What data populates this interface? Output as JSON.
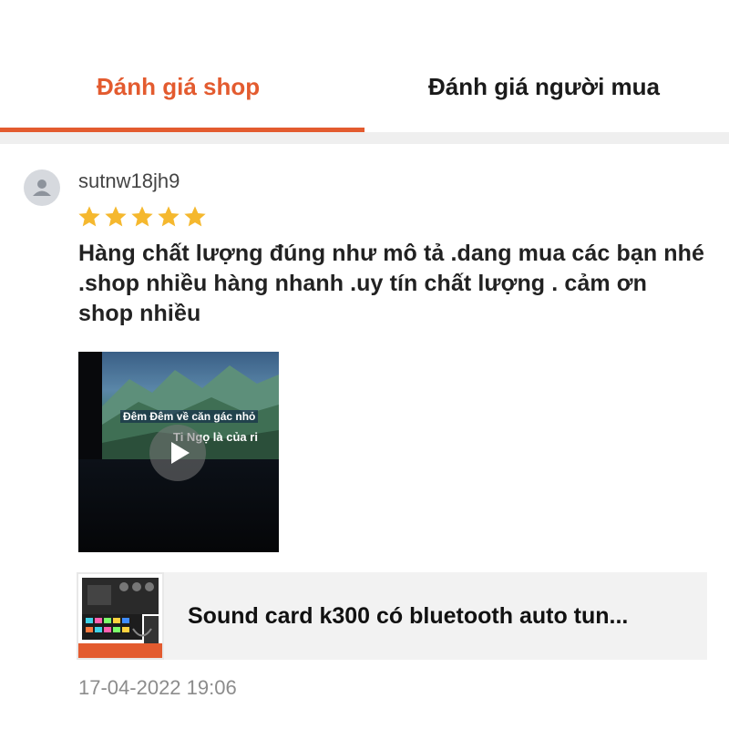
{
  "tabs": [
    {
      "label": "Đánh giá shop",
      "active": true
    },
    {
      "label": "Đánh giá người mua",
      "active": false
    }
  ],
  "colors": {
    "accent": "#e35b2f",
    "star": "#f5b82e",
    "divider": "#efefef"
  },
  "review": {
    "username": "sutnw18jh9",
    "rating": 5,
    "rating_max": 5,
    "text": "Hàng chất lượng đúng như mô tả .dang mua các bạn nhé .shop nhiều hàng nhanh .uy tín chất lượng . cảm ơn shop nhiều",
    "video": {
      "lyric_line_1": "Đêm Đêm về căn gác nhỏ",
      "lyric_line_2": "Ti Ngọ là của ri",
      "play_icon": "play-icon"
    },
    "product": {
      "name": "Sound card k300 có bluetooth auto tun..."
    },
    "timestamp": "17-04-2022 19:06"
  },
  "icons": {
    "avatar": "user-silhouette-icon",
    "star": "star-icon"
  }
}
